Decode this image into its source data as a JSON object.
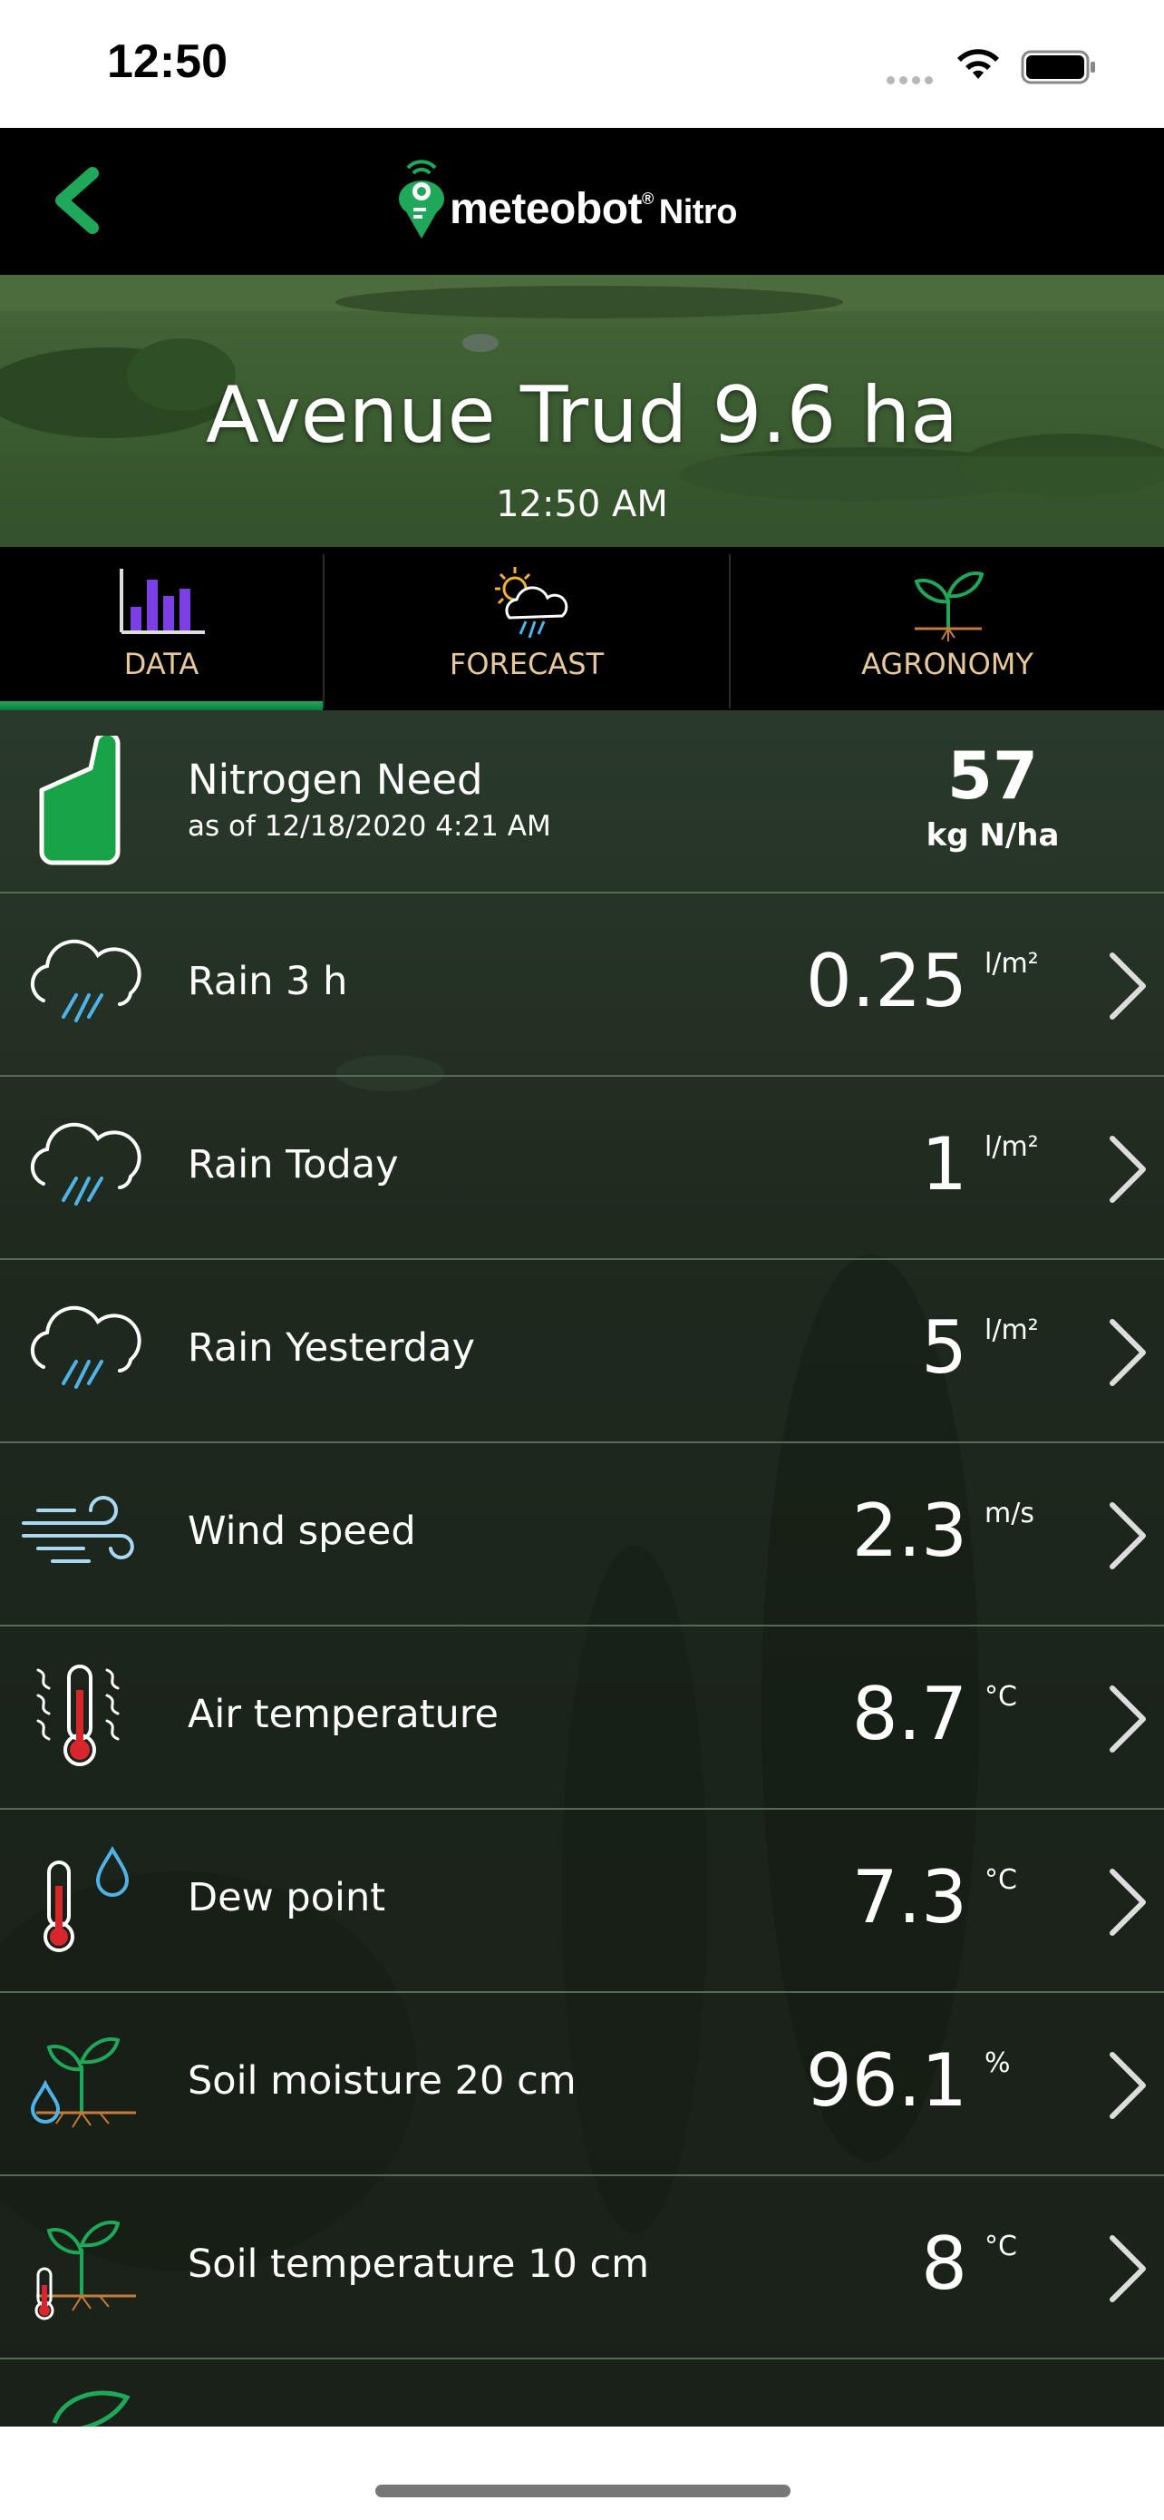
{
  "status": {
    "time": "12:50"
  },
  "brand": {
    "name": "meteobot",
    "reg": "®",
    "sub": "Nitro"
  },
  "field": {
    "title": "Avenue Trud 9.6 ha",
    "time": "12:50 AM"
  },
  "tabs": [
    {
      "label": "DATA",
      "icon": "bar-chart-icon",
      "active": true
    },
    {
      "label": "FORECAST",
      "icon": "sun-cloud-rain-icon",
      "active": false
    },
    {
      "label": "AGRONOMY",
      "icon": "sprout-icon",
      "active": false
    }
  ],
  "nitrogen": {
    "label": "Nitrogen Need",
    "date": "as of 12/18/2020 4:21 AM",
    "value": "57",
    "unit": "kg N/ha"
  },
  "rows": [
    {
      "label": "Rain 3 h",
      "value": "0.25",
      "unit": "l/m²",
      "icon": "rain-cloud-icon"
    },
    {
      "label": "Rain Today",
      "value": "1",
      "unit": "l/m²",
      "icon": "rain-cloud-icon"
    },
    {
      "label": "Rain Yesterday",
      "value": "5",
      "unit": "l/m²",
      "icon": "rain-cloud-icon"
    },
    {
      "label": "Wind speed",
      "value": "2.3",
      "unit": "m/s",
      "icon": "wind-icon"
    },
    {
      "label": "Air temperature",
      "value": "8.7",
      "unit": "°C",
      "icon": "air-temperature-icon"
    },
    {
      "label": "Dew point",
      "value": "7.3",
      "unit": "°C",
      "icon": "dew-point-icon"
    },
    {
      "label": "Soil moisture 20 cm",
      "value": "96.1",
      "unit": "%",
      "icon": "soil-moisture-icon"
    },
    {
      "label": "Soil temperature 10 cm",
      "value": "8",
      "unit": "°C",
      "icon": "soil-temperature-icon"
    }
  ],
  "colors": {
    "accent_green": "#1fa85a",
    "tab_label": "#e6c89a",
    "rain_blue": "#4fb3e8",
    "thermo_red": "#d8262c"
  }
}
